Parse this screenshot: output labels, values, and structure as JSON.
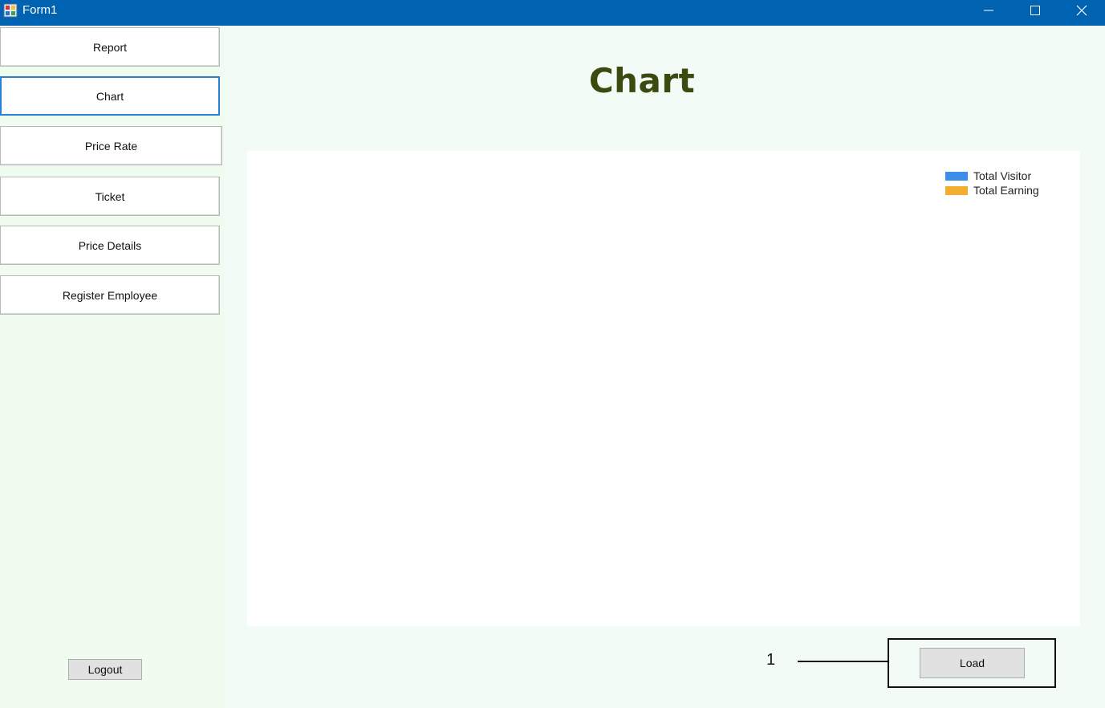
{
  "window": {
    "title": "Form1",
    "controls": {
      "minimize": "minimize-icon",
      "maximize": "maximize-icon",
      "close": "close-icon"
    },
    "titlebar_color": "#0063b1"
  },
  "sidebar": {
    "items": [
      {
        "label": "Report",
        "active": false
      },
      {
        "label": "Chart",
        "active": true
      },
      {
        "label": "Price Rate",
        "active": false
      },
      {
        "label": "Ticket",
        "active": false
      },
      {
        "label": "Price Details",
        "active": false
      },
      {
        "label": "Register Employee",
        "active": false
      }
    ],
    "logout_label": "Logout"
  },
  "main": {
    "title": "Chart",
    "load_label": "Load",
    "callout_number": "1"
  },
  "chart_data": {
    "type": "bar",
    "categories": [],
    "series": [
      {
        "name": "Total Visitor",
        "values": [],
        "color": "#3d8ee8"
      },
      {
        "name": "Total Earning",
        "values": [],
        "color": "#f5ad2f"
      }
    ],
    "legend_position": "top-right",
    "grid": false
  }
}
